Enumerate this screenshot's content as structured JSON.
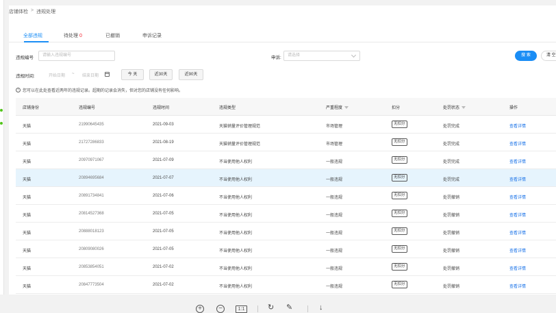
{
  "breadcrumb": [
    "店铺体检",
    "违规处理"
  ],
  "tabs": [
    {
      "label": "全部违规",
      "active": true
    },
    {
      "label": "待处理",
      "count": "0"
    },
    {
      "label": "已撤销"
    },
    {
      "label": "申诉记录"
    }
  ],
  "filters": {
    "violation_no_label": "违规编号",
    "violation_no_placeholder": "请输入违规编号",
    "appeal_label": "申诉:",
    "appeal_placeholder": "请选择",
    "time_label": "违规时间:",
    "start_placeholder": "开始日期",
    "range_sep": "~",
    "end_placeholder": "结束日期",
    "chips": [
      "今 天",
      "近30天",
      "近90天"
    ],
    "search_label": "搜 索",
    "reset_label": "清 空"
  },
  "notice": "您可以在此处查看近两年的违规记录。超期的记录会消失，但对您的店铺没有任何影响。",
  "table": {
    "headers": [
      "店铺身份",
      "违规编号",
      "违规时间",
      "违规类型",
      "严重程度",
      "扣分",
      "处罚状态",
      "操作"
    ],
    "rows": [
      [
        "天猫",
        "21990645435",
        "2021-09-03",
        "天猫销量评价管理规范",
        "市场管理",
        "无扣分",
        "处罚完成",
        "查看详情"
      ],
      [
        "天猫",
        "21727286833",
        "2021-08-19",
        "天猫销量评价管理规范",
        "市场管理",
        "无扣分",
        "处罚完成",
        "查看详情"
      ],
      [
        "天猫",
        "20970971067",
        "2021-07-09",
        "不当使用他人权利",
        "一般违规",
        "无扣分",
        "处罚完成",
        "查看详情"
      ],
      [
        "天猫",
        "20894695684",
        "2021-07-07",
        "不当使用他人权利",
        "一般违规",
        "无扣分",
        "处罚完成",
        "查看详情"
      ],
      [
        "天猫",
        "20891734841",
        "2021-07-06",
        "不当使用他人权利",
        "一般违规",
        "无扣分",
        "处罚撤销",
        "查看详情"
      ],
      [
        "天猫",
        "20814527368",
        "2021-07-05",
        "不当使用他人权利",
        "一般违规",
        "无扣分",
        "处罚撤销",
        "查看详情"
      ],
      [
        "天猫",
        "20888018123",
        "2021-07-05",
        "不当使用他人权利",
        "一般违规",
        "无扣分",
        "处罚撤销",
        "查看详情"
      ],
      [
        "天猫",
        "20809080026",
        "2021-07-05",
        "不当使用他人权利",
        "一般违规",
        "无扣分",
        "处罚撤销",
        "查看详情"
      ],
      [
        "天猫",
        "20853854051",
        "2021-07-02",
        "不当使用他人权利",
        "一般违规",
        "无扣分",
        "处罚撤销",
        "查看详情"
      ],
      [
        "天猫",
        "20847773504",
        "2021-07-02",
        "不当使用他人权利",
        "一般违规",
        "无扣分",
        "处罚撤销",
        "查看详情"
      ]
    ],
    "highlight_row": 3
  },
  "toolbar": {
    "zoom_in": "+",
    "zoom_out": "−",
    "fit": "1:1",
    "rotate": "↻",
    "edit": "✎",
    "download": "↓"
  },
  "colors": {
    "accent": "#1a8df5",
    "count": "#f5222d",
    "link": "#1a73e8",
    "row_highlight": "#e6f4fd"
  }
}
